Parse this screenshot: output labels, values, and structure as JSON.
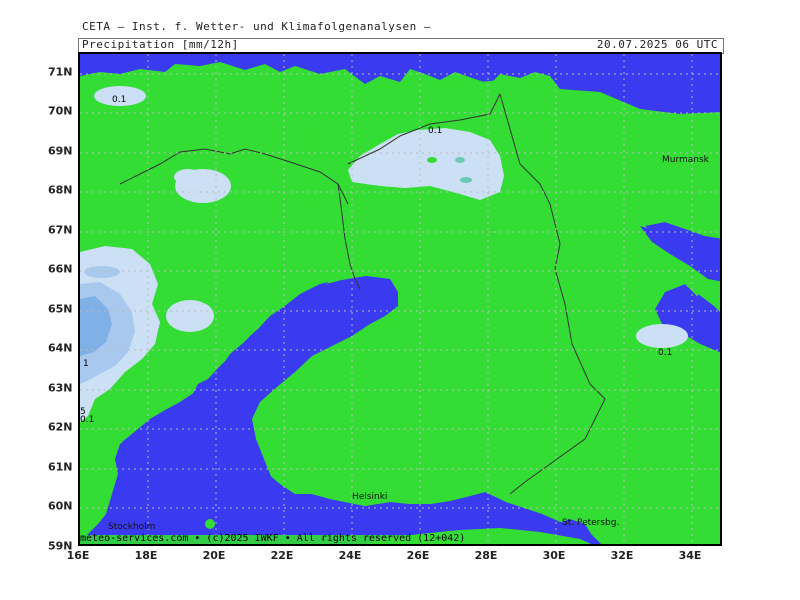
{
  "header": {
    "institute": "CETA – Inst. f. Wetter- und Klimafolgenanalysen –",
    "parameter": "Precipitation [mm/12h]",
    "valid_time": "20.07.2025 06 UTC"
  },
  "axes": {
    "lat_labels": [
      "71N",
      "70N",
      "69N",
      "68N",
      "67N",
      "66N",
      "65N",
      "64N",
      "63N",
      "62N",
      "61N",
      "60N",
      "59N"
    ],
    "lon_labels": [
      "16E",
      "18E",
      "20E",
      "22E",
      "24E",
      "26E",
      "28E",
      "30E",
      "32E",
      "34E"
    ]
  },
  "places": {
    "murmansk": "Murmansk",
    "helsinki": "Helsinki",
    "stockholm": "Stockholm",
    "st_petersburg": "St. Petersbg."
  },
  "contour_labels": {
    "norway_north": "0.1",
    "finland_north": "0.1",
    "russia_east": "0.1",
    "sweden_west_1": "1",
    "sweden_west_5": "5",
    "sweden_west_01": "0.1"
  },
  "footer": "meteo-services.com • (c)2025 IWKF • All rights reserved (12+042)",
  "colors": {
    "sea": "#3a3af0",
    "land_dry": "#33dd33",
    "precip_0_1": "#cce0f5",
    "precip_1": "#a8c8ee",
    "precip_5": "#7fb0e6"
  }
}
